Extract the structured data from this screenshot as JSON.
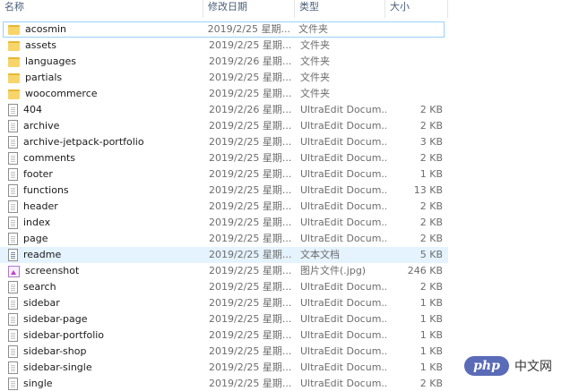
{
  "columns": {
    "name": "名称",
    "date": "修改日期",
    "type": "类型",
    "size": "大小"
  },
  "rows": [
    {
      "name": "acosmin",
      "date": "2019/2/25 星期...",
      "type": "文件夹",
      "size": "",
      "icon": "folder-icon"
    },
    {
      "name": "assets",
      "date": "2019/2/25 星期...",
      "type": "文件夹",
      "size": "",
      "icon": "folder-icon"
    },
    {
      "name": "languages",
      "date": "2019/2/26 星期...",
      "type": "文件夹",
      "size": "",
      "icon": "folder-icon"
    },
    {
      "name": "partials",
      "date": "2019/2/25 星期...",
      "type": "文件夹",
      "size": "",
      "icon": "folder-icon"
    },
    {
      "name": "woocommerce",
      "date": "2019/2/25 星期...",
      "type": "文件夹",
      "size": "",
      "icon": "folder-icon"
    },
    {
      "name": "404",
      "date": "2019/2/26 星期...",
      "type": "UltraEdit Docum...",
      "size": "2 KB",
      "icon": "document-icon"
    },
    {
      "name": "archive",
      "date": "2019/2/25 星期...",
      "type": "UltraEdit Docum...",
      "size": "2 KB",
      "icon": "document-icon"
    },
    {
      "name": "archive-jetpack-portfolio",
      "date": "2019/2/25 星期...",
      "type": "UltraEdit Docum...",
      "size": "3 KB",
      "icon": "document-icon"
    },
    {
      "name": "comments",
      "date": "2019/2/25 星期...",
      "type": "UltraEdit Docum...",
      "size": "2 KB",
      "icon": "document-icon"
    },
    {
      "name": "footer",
      "date": "2019/2/25 星期...",
      "type": "UltraEdit Docum...",
      "size": "1 KB",
      "icon": "document-icon"
    },
    {
      "name": "functions",
      "date": "2019/2/25 星期...",
      "type": "UltraEdit Docum...",
      "size": "13 KB",
      "icon": "document-icon"
    },
    {
      "name": "header",
      "date": "2019/2/25 星期...",
      "type": "UltraEdit Docum...",
      "size": "2 KB",
      "icon": "document-icon"
    },
    {
      "name": "index",
      "date": "2019/2/25 星期...",
      "type": "UltraEdit Docum...",
      "size": "2 KB",
      "icon": "document-icon"
    },
    {
      "name": "page",
      "date": "2019/2/25 星期...",
      "type": "UltraEdit Docum...",
      "size": "2 KB",
      "icon": "document-icon"
    },
    {
      "name": "readme",
      "date": "2019/2/25 星期...",
      "type": "文本文档",
      "size": "5 KB",
      "icon": "text-document-icon"
    },
    {
      "name": "screenshot",
      "date": "2019/2/25 星期...",
      "type": "图片文件(.jpg)",
      "size": "246 KB",
      "icon": "image-icon"
    },
    {
      "name": "search",
      "date": "2019/2/25 星期...",
      "type": "UltraEdit Docum...",
      "size": "2 KB",
      "icon": "document-icon"
    },
    {
      "name": "sidebar",
      "date": "2019/2/25 星期...",
      "type": "UltraEdit Docum...",
      "size": "1 KB",
      "icon": "document-icon"
    },
    {
      "name": "sidebar-page",
      "date": "2019/2/25 星期...",
      "type": "UltraEdit Docum...",
      "size": "1 KB",
      "icon": "document-icon"
    },
    {
      "name": "sidebar-portfolio",
      "date": "2019/2/25 星期...",
      "type": "UltraEdit Docum...",
      "size": "1 KB",
      "icon": "document-icon"
    },
    {
      "name": "sidebar-shop",
      "date": "2019/2/25 星期...",
      "type": "UltraEdit Docum...",
      "size": "1 KB",
      "icon": "document-icon"
    },
    {
      "name": "sidebar-single",
      "date": "2019/2/25 星期...",
      "type": "UltraEdit Docum...",
      "size": "1 KB",
      "icon": "document-icon"
    },
    {
      "name": "single",
      "date": "2019/2/25 星期...",
      "type": "UltraEdit Docum...",
      "size": "2 KB",
      "icon": "document-icon"
    }
  ],
  "watermark": {
    "logo": "php",
    "text": "中文网"
  },
  "colors": {
    "hover_row": "#e5f3ff",
    "focus_border": "#99d1ff",
    "folder": "#f7d56b",
    "header_text": "#4c607a"
  }
}
